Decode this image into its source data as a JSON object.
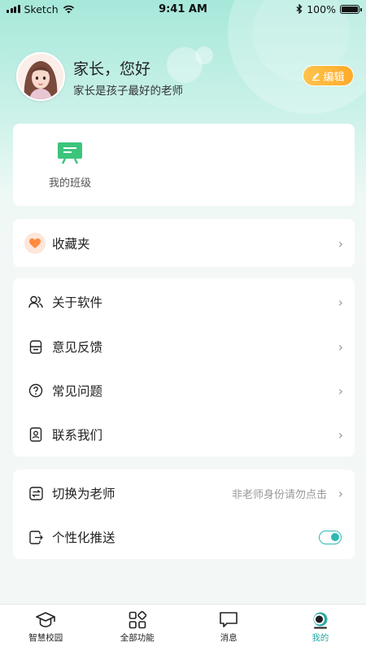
{
  "status_bar": {
    "carrier": "Sketch",
    "time": "9:41 AM",
    "battery": "100%"
  },
  "profile": {
    "greeting": "家长，您好",
    "motto": "家长是孩子最好的老师",
    "edit_label": "编辑"
  },
  "class_section": {
    "label": "我的班级",
    "icon": "classroom-board-icon"
  },
  "favorites": {
    "label": "收藏夹",
    "icon": "heart-icon"
  },
  "menu": [
    {
      "label": "关于软件",
      "icon": "users-icon"
    },
    {
      "label": "意见反馈",
      "icon": "feedback-icon"
    },
    {
      "label": "常见问题",
      "icon": "question-icon"
    },
    {
      "label": "联系我们",
      "icon": "contact-icon"
    }
  ],
  "settings": {
    "switch_label": "切换为老师",
    "switch_hint": "非老师身份请勿点击",
    "push_label": "个性化推送",
    "push_enabled": true
  },
  "tabs": [
    {
      "label": "智慧校园",
      "icon": "graduation-cap-icon"
    },
    {
      "label": "全部功能",
      "icon": "grid-apps-icon"
    },
    {
      "label": "消息",
      "icon": "message-icon"
    },
    {
      "label": "我的",
      "icon": "profile-icon",
      "active": true
    }
  ],
  "colors": {
    "accent": "#2aa9a5",
    "edit_button": "#ffb23a",
    "class_icon": "#3cc47c",
    "heart": "#ff8a3d"
  }
}
